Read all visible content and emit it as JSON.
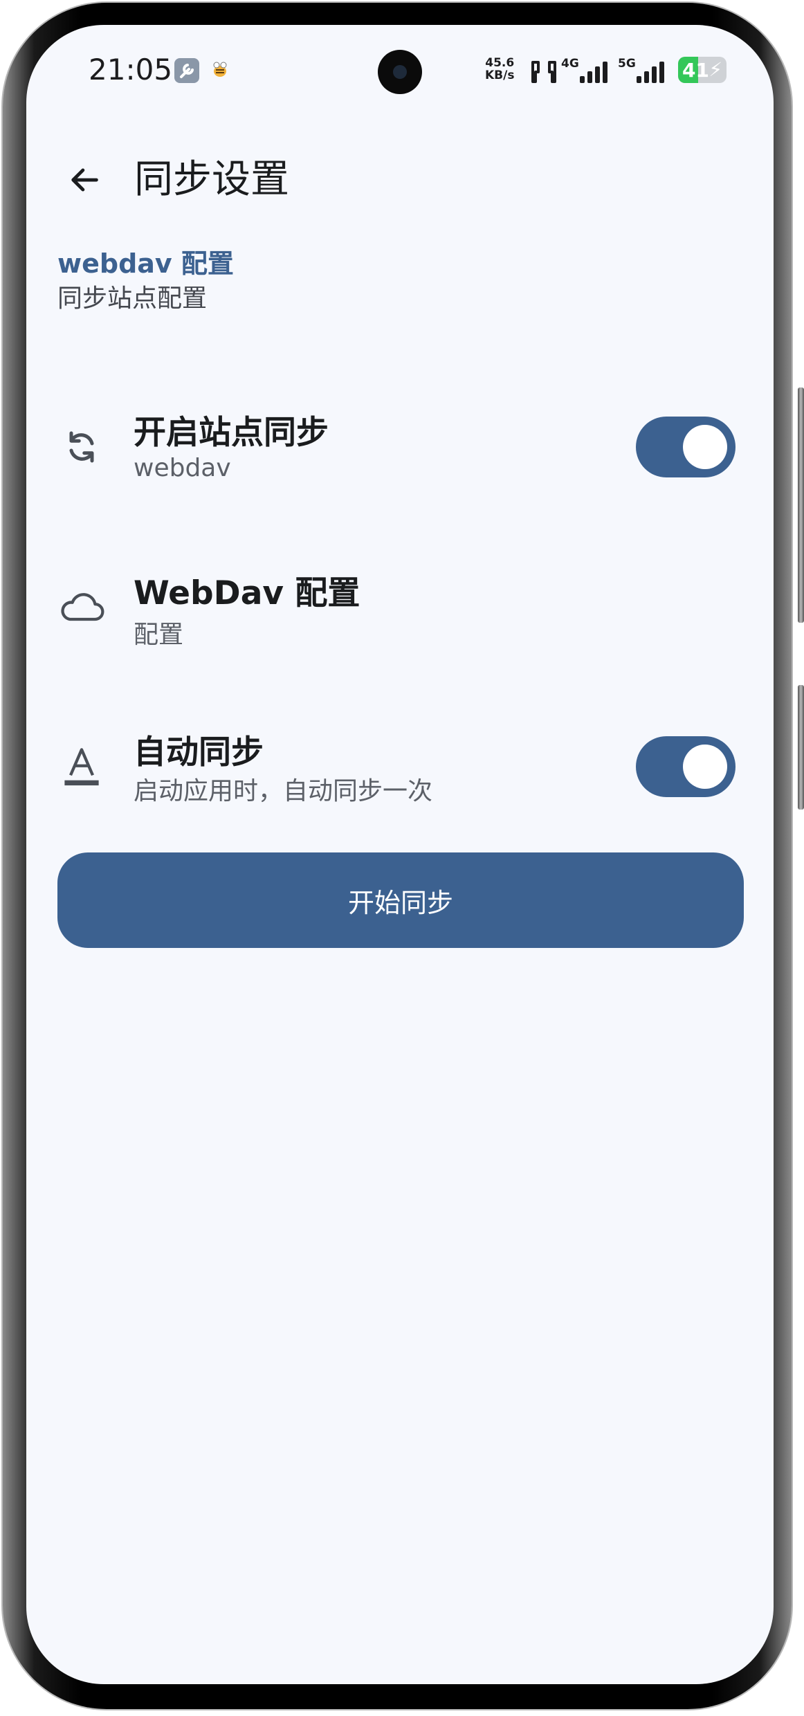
{
  "status_bar": {
    "time": "21:05",
    "net_speed_value": "45.6",
    "net_speed_unit": "KB/s",
    "network_1": "4G",
    "network_2": "5G",
    "battery_level": "41",
    "battery_fraction": 0.41,
    "battery_color": "#34c759",
    "charging": true
  },
  "app_bar": {
    "title": "同步设置",
    "back_icon": "arrow-back-icon"
  },
  "section": {
    "header": "webdav 配置",
    "subtitle": "同步站点配置"
  },
  "settings": [
    {
      "icon": "sync-icon",
      "title": "开启站点同步",
      "subtitle": "webdav",
      "toggle": true
    },
    {
      "icon": "cloud-icon",
      "title": "WebDav 配置",
      "subtitle": "配置"
    },
    {
      "icon": "text-format-icon",
      "title": "自动同步",
      "subtitle": "启动应用时，自动同步一次",
      "toggle": true
    }
  ],
  "action_button": {
    "label": "开始同步"
  },
  "colors": {
    "accent": "#3c6190",
    "background": "#f6f8fd",
    "text_primary": "#1a1c1e",
    "text_secondary": "#5c6068"
  }
}
